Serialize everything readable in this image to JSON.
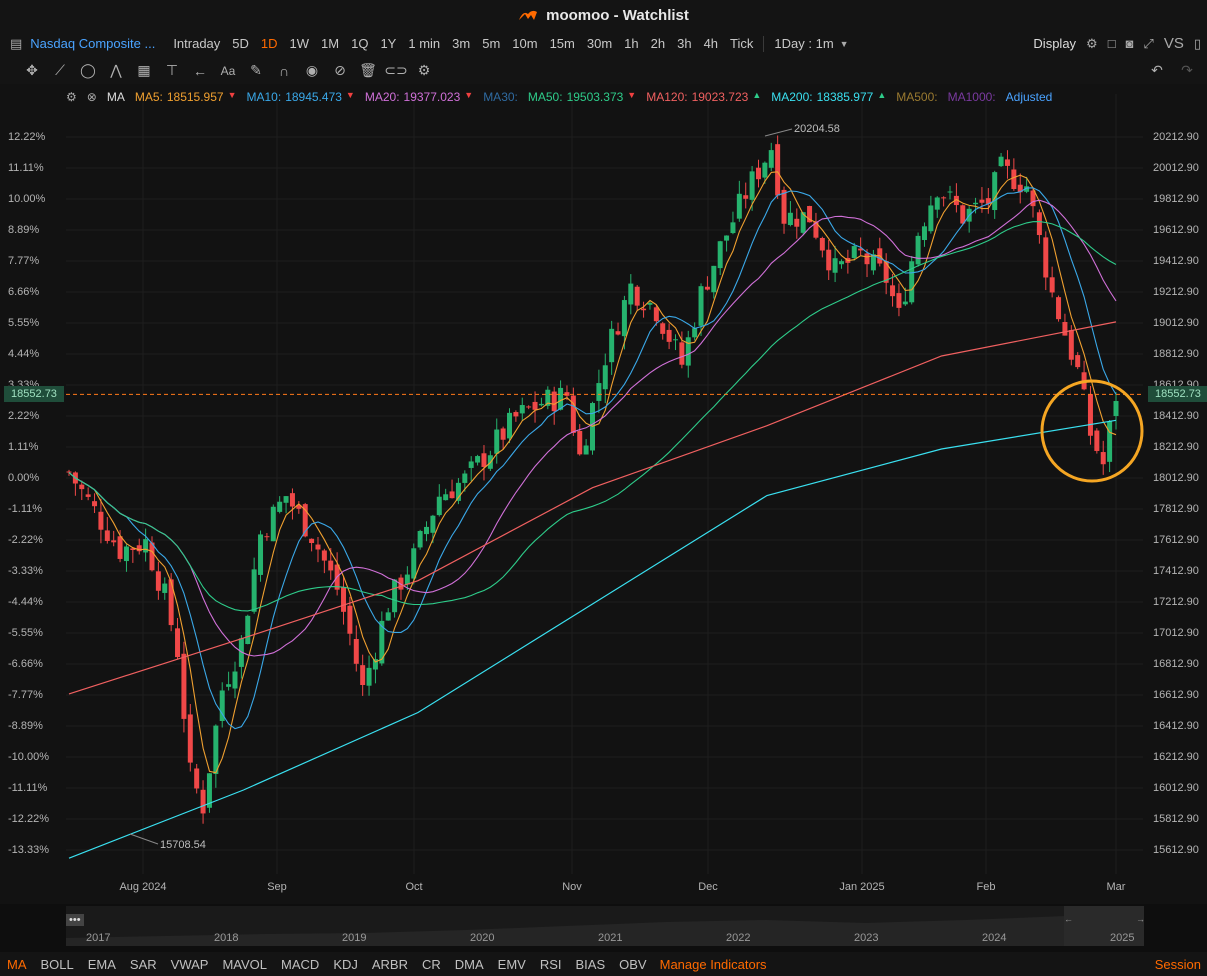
{
  "window": {
    "title": "moomoo - Watchlist"
  },
  "toolbar": {
    "symbol": "Nasdaq Composite ...",
    "intervals": [
      "Intraday",
      "5D",
      "1D",
      "1W",
      "1M",
      "1Q",
      "1Y",
      "1 min",
      "3m",
      "5m",
      "10m",
      "15m",
      "30m",
      "1h",
      "2h",
      "3h",
      "4h",
      "Tick"
    ],
    "active_interval": "1D",
    "multi": "1Day : 1m",
    "display_label": "Display",
    "vs_label": "VS"
  },
  "ma_legend": {
    "label": "MA",
    "items": [
      {
        "name": "MA5:",
        "value": "18515.957",
        "color": "#f0a030",
        "arrow": "▼",
        "arrow_color": "#f04040"
      },
      {
        "name": "MA10:",
        "value": "18945.473",
        "color": "#3aa8e8",
        "arrow": "▼",
        "arrow_color": "#f04040"
      },
      {
        "name": "MA20:",
        "value": "19377.023",
        "color": "#d070d8",
        "arrow": "▼",
        "arrow_color": "#f04040"
      },
      {
        "name": "MA30:",
        "value": "",
        "color": "#2f6aa0",
        "arrow": "",
        "arrow_color": ""
      },
      {
        "name": "MA50:",
        "value": "19503.373",
        "color": "#2ecc8a",
        "arrow": "▼",
        "arrow_color": "#f04040"
      },
      {
        "name": "MA120:",
        "value": "19023.723",
        "color": "#f06060",
        "arrow": "▲",
        "arrow_color": "#2ecc8a"
      },
      {
        "name": "MA200:",
        "value": "18385.977",
        "color": "#3ae0f0",
        "arrow": "▲",
        "arrow_color": "#2ecc8a"
      },
      {
        "name": "MA500:",
        "value": "",
        "color": "#9a7a30",
        "arrow": "",
        "arrow_color": ""
      },
      {
        "name": "MA1000:",
        "value": "",
        "color": "#7a3aa0",
        "arrow": "",
        "arrow_color": ""
      }
    ],
    "adjusted_label": "Adjusted"
  },
  "axes": {
    "left_pct": [
      "12.22%",
      "11.11%",
      "10.00%",
      "8.89%",
      "7.77%",
      "6.66%",
      "5.55%",
      "4.44%",
      "3.33%",
      "2.22%",
      "1.11%",
      "0.00%",
      "-1.11%",
      "-2.22%",
      "-3.33%",
      "-4.44%",
      "-5.55%",
      "-6.66%",
      "-7.77%",
      "-8.89%",
      "-10.00%",
      "-11.11%",
      "-12.22%",
      "-13.33%"
    ],
    "right_price": [
      "20212.90",
      "20012.90",
      "19812.90",
      "19612.90",
      "19412.90",
      "19212.90",
      "19012.90",
      "18812.90",
      "18612.90",
      "18412.90",
      "18212.90",
      "18012.90",
      "17812.90",
      "17612.90",
      "17412.90",
      "17212.90",
      "17012.90",
      "16812.90",
      "16612.90",
      "16412.90",
      "16212.90",
      "16012.90",
      "15812.90",
      "15612.90"
    ],
    "x_months": [
      "Aug 2024",
      "Sep",
      "Oct",
      "Nov",
      "Dec",
      "Jan 2025",
      "Feb",
      "Mar"
    ],
    "nav_years": [
      "2017",
      "2018",
      "2019",
      "2020",
      "2021",
      "2022",
      "2023",
      "2024",
      "2025"
    ]
  },
  "price": {
    "current": "18552.73",
    "high_label": "20204.58",
    "low_label": "15708.54",
    "up_color": "#26b36e",
    "down_color": "#f04848",
    "line_color": "#ff7a1a"
  },
  "chart_data": {
    "type": "line",
    "ylim": [
      15520,
      20300
    ],
    "x": [
      "Aug 2024",
      "Sep",
      "Oct",
      "Nov",
      "Dec",
      "Jan 2025",
      "Feb",
      "Mar"
    ],
    "series": [
      {
        "name": "MA200",
        "color": "#3ae0f0",
        "values": [
          15560,
          16000,
          16500,
          17200,
          17900,
          18200,
          18385
        ]
      },
      {
        "name": "MA120",
        "color": "#f06060",
        "values": [
          16620,
          16980,
          17350,
          17950,
          18350,
          18800,
          19020
        ]
      }
    ],
    "current_price": 18552.73
  },
  "bottom_indicators": {
    "items": [
      "MA",
      "BOLL",
      "EMA",
      "SAR",
      "VWAP",
      "MAVOL",
      "MACD",
      "KDJ",
      "ARBR",
      "CR",
      "DMA",
      "EMV",
      "RSI",
      "BIAS",
      "OBV"
    ],
    "active": "MA",
    "manage": "Manage Indicators",
    "session": "Session"
  }
}
